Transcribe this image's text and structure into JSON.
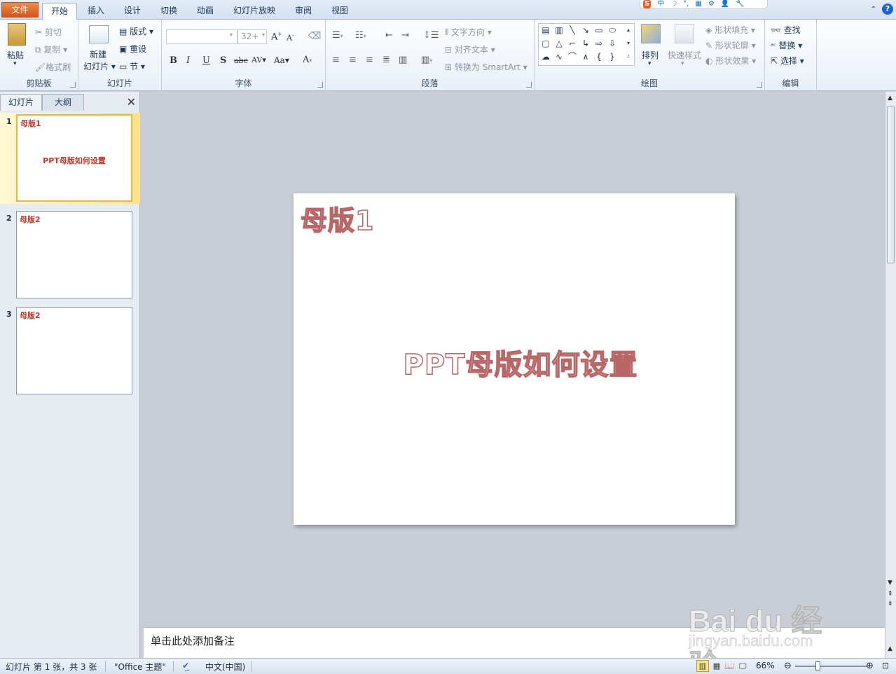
{
  "tabs": {
    "file": "文件",
    "home": "开始",
    "insert": "插入",
    "design": "设计",
    "transitions": "切换",
    "animations": "动画",
    "slideshow": "幻灯片放映",
    "review": "审阅",
    "view": "视图"
  },
  "ime_toolbar": {
    "logo": "S",
    "mode": "中",
    "moon": "☽",
    "punct": "°,",
    "keyboard": "▦",
    "gear": "⚙",
    "user": "👤",
    "tool": "🔧"
  },
  "ribbon": {
    "clipboard": {
      "label": "剪贴板",
      "paste": "粘贴",
      "cut": "剪切",
      "copy": "复制",
      "format_painter": "格式刷"
    },
    "slides": {
      "label": "幻灯片",
      "new_slide_line1": "新建",
      "new_slide_line2": "幻灯片",
      "layout": "版式",
      "reset": "重设",
      "section": "节"
    },
    "font": {
      "label": "字体",
      "font_name": "",
      "font_size": "32+",
      "bold": "B",
      "italic": "I",
      "underline": "U",
      "shadow": "S",
      "strike": "abc",
      "spacing": "AV",
      "case": "Aa",
      "color": "A"
    },
    "paragraph": {
      "label": "段落",
      "text_direction": "文字方向",
      "align_text": "对齐文本",
      "convert_smartart": "转换为 SmartArt"
    },
    "drawing": {
      "label": "绘图",
      "arrange": "排列",
      "quick_styles": "快速样式",
      "shape_fill": "形状填充",
      "shape_outline": "形状轮廓",
      "shape_effects": "形状效果"
    },
    "editing": {
      "label": "编辑",
      "find": "查找",
      "replace": "替换",
      "select": "选择"
    }
  },
  "panel": {
    "tab_slides": "幻灯片",
    "tab_outline": "大纲",
    "thumbnails": [
      {
        "num": "1",
        "title": "母版1",
        "subtitle": "PPT母版如何设置"
      },
      {
        "num": "2",
        "title": "母版2",
        "subtitle": ""
      },
      {
        "num": "3",
        "title": "母版2",
        "subtitle": ""
      }
    ]
  },
  "slide": {
    "title": "母版1",
    "subtitle": "PPT母版如何设置"
  },
  "notes_placeholder": "单击此处添加备注",
  "status": {
    "slide_info": "幻灯片 第 1 张，共 3 张",
    "theme": "\"Office 主题\"",
    "language": "中文(中国)",
    "zoom": "66%",
    "zoom_fraction": 0.66
  },
  "watermark": {
    "brand": "Bai du 经验",
    "url": "jingyan.baidu.com"
  },
  "colors": {
    "file_tab": "#d5531a",
    "slide_text_outline": "#b96666",
    "thumb_text": "#c0392b",
    "selected_thumb": "#f0b43a"
  }
}
